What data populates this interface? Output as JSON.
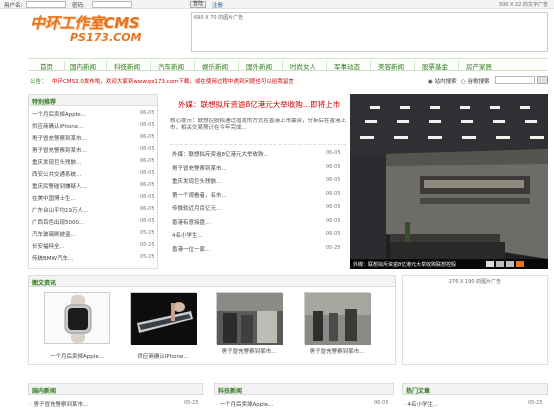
{
  "topbar": {
    "username_label": "用户名:",
    "password_label": "密码:",
    "login_button": "登陆",
    "register_link": "注册",
    "ad_text": "500 X 22 的文字广告"
  },
  "logo": {
    "line1": "中环工作室CMS",
    "line2": "PS173.COM"
  },
  "banner": {
    "text": "690 X 70 的图片广告"
  },
  "nav": {
    "items": [
      "首页",
      "国内新闻",
      "科技新闻",
      "汽车新闻",
      "娱乐新闻",
      "国外新闻",
      "时尚女人",
      "军事动态",
      "美容新闻",
      "股票基金",
      "房产家居"
    ]
  },
  "notice": {
    "label": "公告：",
    "text": "中环CMS2.0发布啦，欢迎大家到www.ps173.com下载，或在使用过程中遇到问题也可以给我留言",
    "radio_site": "站内搜索",
    "radio_google": "谷歌搜索"
  },
  "left": {
    "title": "特别推荐",
    "items": [
      {
        "title": "一个月后卖掉Apple...",
        "date": "06-05"
      },
      {
        "title": "供应商确认iPhone...",
        "date": "06-05"
      },
      {
        "title": "男子冒充警察到某市...",
        "date": "06-05"
      },
      {
        "title": "男子冒充警察到某市...",
        "date": "06-05"
      },
      {
        "title": "重庆发现巨头残骸...",
        "date": "06-05"
      },
      {
        "title": "西安公共交通系统...",
        "date": "06-05"
      },
      {
        "title": "重庆民警碰到嫌疑人...",
        "date": "06-05"
      },
      {
        "title": "在美中国博士生...",
        "date": "06-05"
      },
      {
        "title": "广东台山平均19万人...",
        "date": "06-05"
      },
      {
        "title": "广西百色出现5000...",
        "date": "06-05"
      },
      {
        "title": "汽车玻璃刷被盗...",
        "date": "05-25"
      },
      {
        "title": "长安福特全...",
        "date": "05-25"
      },
      {
        "title": "传统BMW汽车...",
        "date": "05-25"
      }
    ]
  },
  "middle": {
    "headline": "外媒：联想拟斥资逾8亿港元大举收购…即将上市",
    "summary": "核心提示：联想控股拟通过增发的方式在香港上市募资，分拆后在香港上市，相关交易预计在今年完成...",
    "items": [
      {
        "title": "外媒：联想拟斥资逾8亿港元大举收购...",
        "date": "06-05"
      },
      {
        "title": "男子冒充警察到某市...",
        "date": "06-05"
      },
      {
        "title": "重庆发现巨头残骸...",
        "date": "06-05"
      },
      {
        "title": "第一个观看者，名市...",
        "date": "06-05"
      },
      {
        "title": "传微软近月百亿元...",
        "date": "06-05"
      },
      {
        "title": "香港有意接盘...",
        "date": "06-05"
      },
      {
        "title": "4名小学生...",
        "date": "06-05"
      },
      {
        "title": "香港一位一家...",
        "date": "05-25"
      }
    ]
  },
  "photo": {
    "caption": "外媒：联想拟斥资逾8亿港元大举收购联想控股"
  },
  "pics": {
    "title": "图文资讯",
    "items": [
      "一个月后卖掉Apple...",
      "供应商确认iPhone...",
      "男子冒充警察到某市...",
      "男子冒充警察到某市..."
    ]
  },
  "ad2": {
    "text": "276 X 190 的图片广告"
  },
  "bottom": {
    "box1": {
      "title": "国内新闻",
      "item": "男子冒充警察到某市...",
      "date": "05-25"
    },
    "box2": {
      "title": "科技新闻",
      "item": "一个月后卖掉Apple...",
      "date": "06-05"
    },
    "box3": {
      "title": "热门文章",
      "item": "4名小学生...",
      "date": "05-25"
    }
  }
}
